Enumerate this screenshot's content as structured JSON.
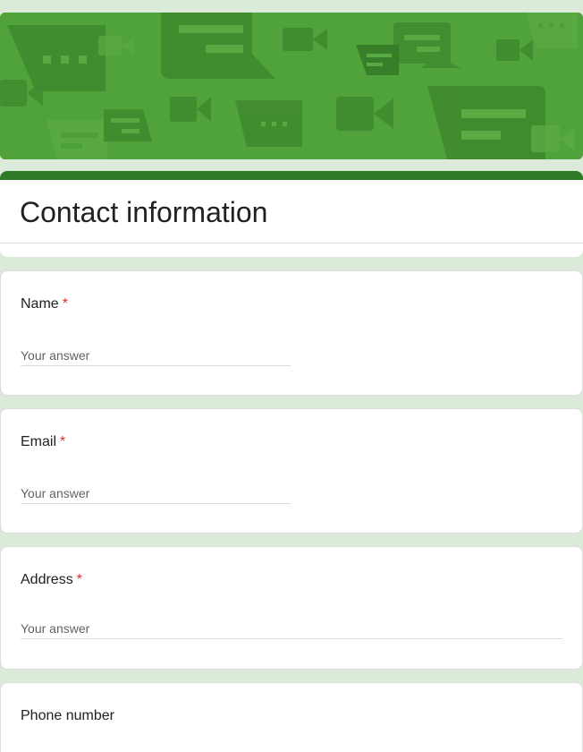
{
  "form": {
    "title": "Contact information",
    "accent_color": "#2f7a27",
    "banner_color": "#4c9f38",
    "background_color": "#dcebd9"
  },
  "banner": {
    "pattern": [
      "chat-bubble-icon",
      "video-camera-icon",
      "message-icon"
    ]
  },
  "questions": [
    {
      "label": "Name",
      "required_mark": "*",
      "placeholder": "Your answer"
    },
    {
      "label": "Email",
      "required_mark": "*",
      "placeholder": "Your answer"
    },
    {
      "label": "Address",
      "required_mark": "*",
      "placeholder": "Your answer"
    },
    {
      "label": "Phone number"
    }
  ]
}
